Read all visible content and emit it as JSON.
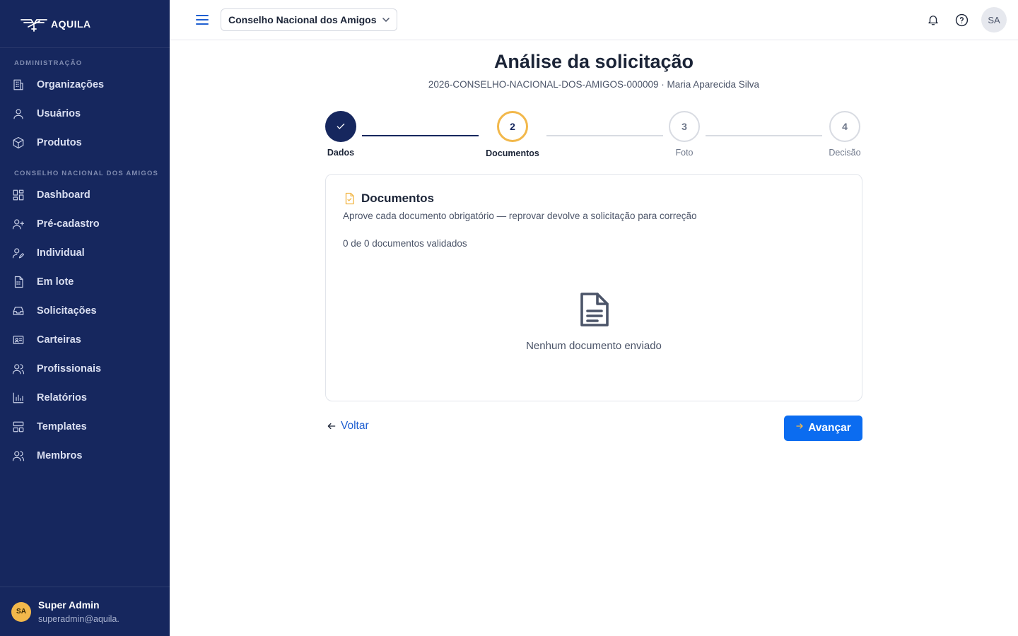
{
  "brand": {
    "name": "AQUILA"
  },
  "sidebar": {
    "sections": [
      {
        "title": "ADMINISTRAÇÃO",
        "items": [
          {
            "label": "Organizações",
            "icon": "building-icon"
          },
          {
            "label": "Usuários",
            "icon": "user-icon"
          },
          {
            "label": "Produtos",
            "icon": "box-icon"
          }
        ]
      },
      {
        "title": "CONSELHO NACIONAL DOS AMIGOS",
        "items": [
          {
            "label": "Dashboard",
            "icon": "dashboard-icon"
          },
          {
            "label": "Pré-cadastro",
            "icon": "user-plus-icon"
          },
          {
            "label": "Individual",
            "icon": "user-edit-icon"
          },
          {
            "label": "Em lote",
            "icon": "file-grid-icon"
          },
          {
            "label": "Solicitações",
            "icon": "inbox-icon"
          },
          {
            "label": "Carteiras",
            "icon": "id-card-icon"
          },
          {
            "label": "Profissionais",
            "icon": "users-icon"
          },
          {
            "label": "Relatórios",
            "icon": "bar-chart-icon"
          },
          {
            "label": "Templates",
            "icon": "template-icon"
          },
          {
            "label": "Membros",
            "icon": "members-icon"
          }
        ]
      }
    ],
    "user": {
      "initials": "SA",
      "name": "Super Admin",
      "email": "superadmin@aquila."
    }
  },
  "topbar": {
    "org_name": "Conselho Nacional dos Amigos",
    "avatar_initials": "SA"
  },
  "page": {
    "title": "Análise da solicitação",
    "subtitle": "2026-CONSELHO-NACIONAL-DOS-AMIGOS-000009 · Maria Aparecida Silva"
  },
  "stepper": {
    "steps": [
      {
        "number": "1",
        "label": "Dados",
        "state": "done"
      },
      {
        "number": "2",
        "label": "Documentos",
        "state": "active"
      },
      {
        "number": "3",
        "label": "Foto",
        "state": "pending"
      },
      {
        "number": "4",
        "label": "Decisão",
        "state": "pending"
      }
    ]
  },
  "documents": {
    "title": "Documentos",
    "description": "Aprove cada documento obrigatório — reprovar devolve a solicitação para correção",
    "count_text": "0 de 0 documentos validados",
    "empty_text": "Nenhum documento enviado"
  },
  "actions": {
    "back_label": "Voltar",
    "next_label": "Avançar"
  },
  "colors": {
    "sidebar_bg": "#16275e",
    "primary_button": "#0b6cf0",
    "active_step_ring": "#f2b84b",
    "link": "#1f5fd1"
  }
}
